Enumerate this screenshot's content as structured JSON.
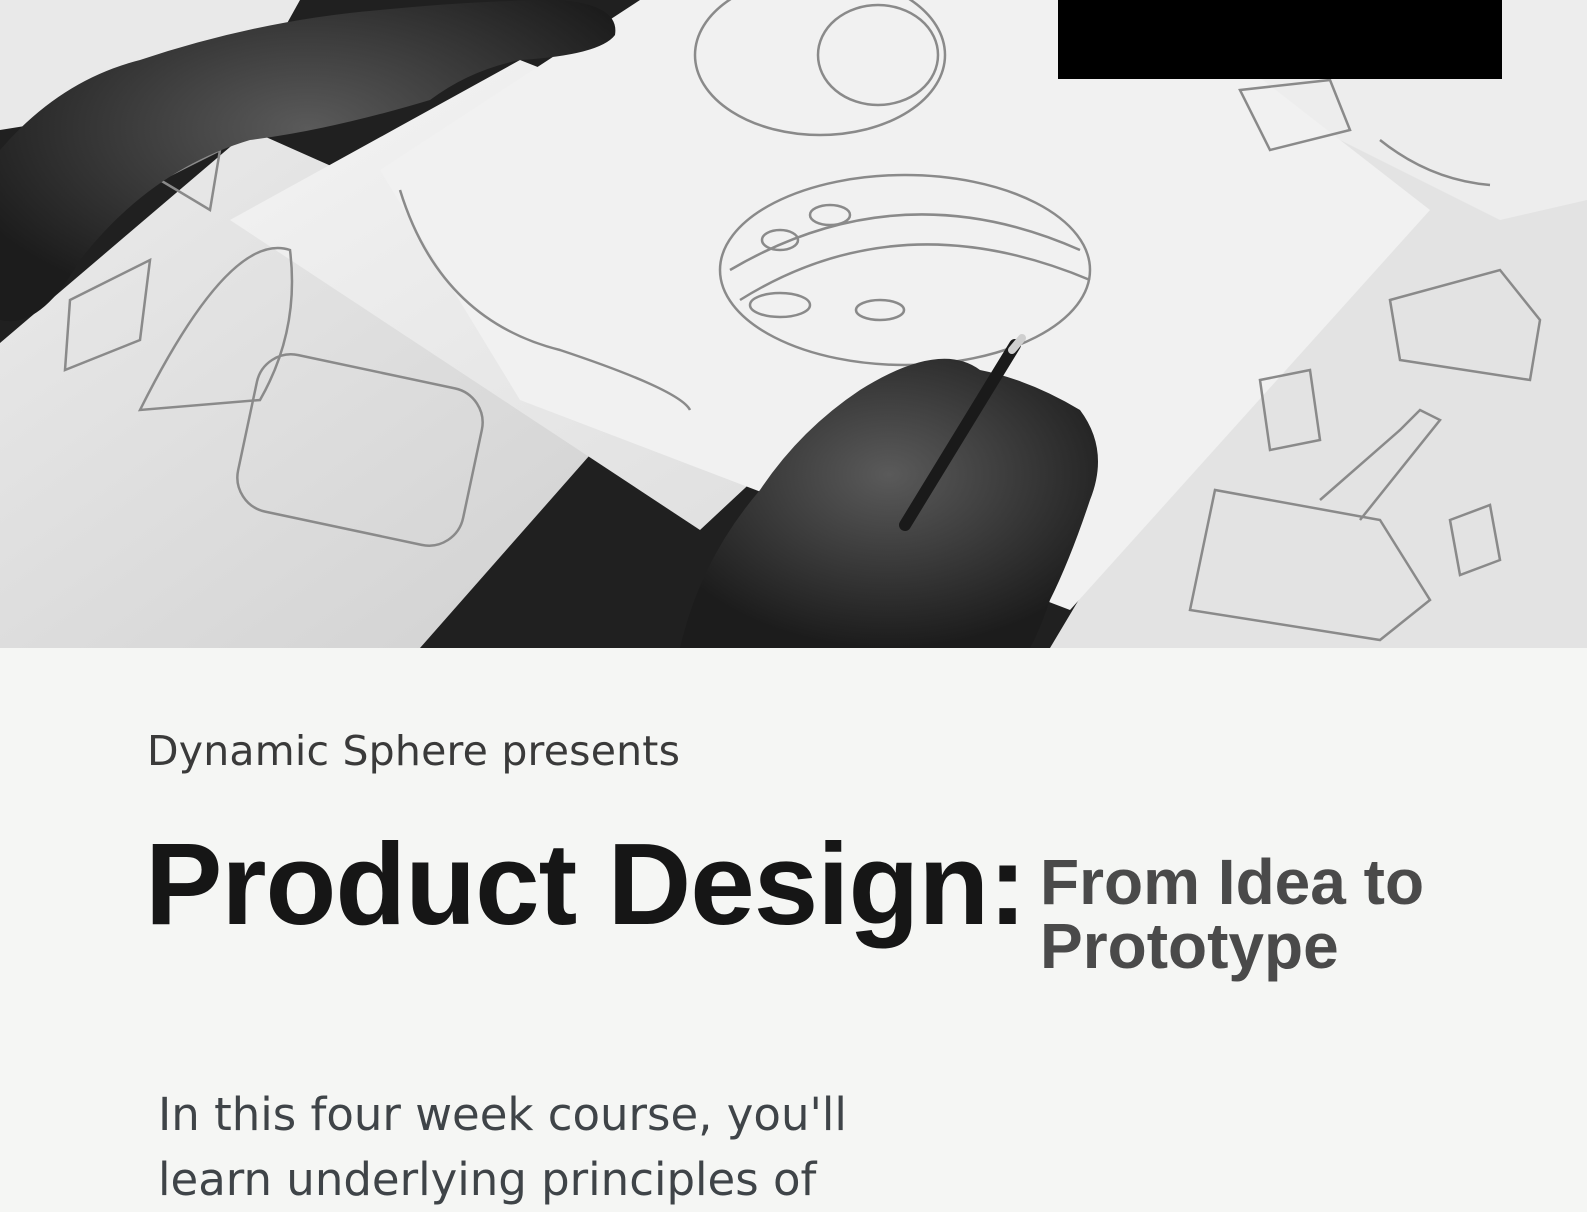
{
  "hero": {
    "image_description_icon": "sketching-hands-photo-icon"
  },
  "presenter": "Dynamic Sphere presents",
  "title": "Product Design:",
  "subtitle": "From Idea to Prototype",
  "body": "In this four week course, you'll learn underlying principles of",
  "colors": {
    "background": "#f5f6f4",
    "title": "#161616",
    "subtitle": "#4a4a4a",
    "body": "#3f4448",
    "block": "#000000"
  }
}
